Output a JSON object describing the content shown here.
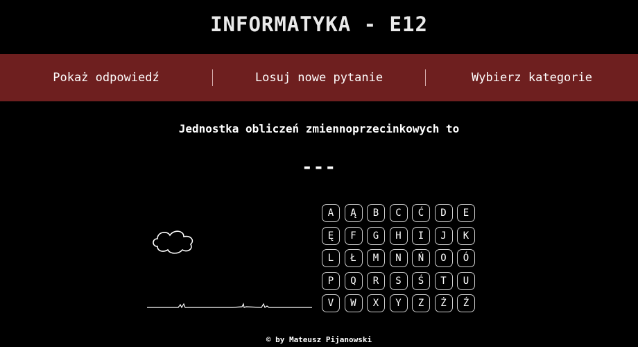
{
  "header": {
    "title": "INFORMATYKA - E12"
  },
  "menu": {
    "show_answer": "Pokaż odpowiedź",
    "new_question": "Losuj nowe pytanie",
    "choose_category": "Wybierz kategorie"
  },
  "question": {
    "text": "Jednostka obliczeń zmiennoprzecinkowych to"
  },
  "answer": {
    "masked": "---"
  },
  "keyboard": {
    "keys": [
      "A",
      "Ą",
      "B",
      "C",
      "Ć",
      "D",
      "E",
      "Ę",
      "F",
      "G",
      "H",
      "I",
      "J",
      "K",
      "L",
      "Ł",
      "M",
      "N",
      "Ń",
      "O",
      "Ó",
      "P",
      "Q",
      "R",
      "S",
      "Ś",
      "T",
      "U",
      "V",
      "W",
      "X",
      "Y",
      "Z",
      "Ż",
      "Ź"
    ]
  },
  "footer": {
    "text": "© by Mateusz Pijanowski"
  },
  "colors": {
    "background": "#000000",
    "menu_bar": "#6e1f1f",
    "text": "#ffffff"
  },
  "icons": {
    "scene": "cloud-and-ground-icon"
  }
}
